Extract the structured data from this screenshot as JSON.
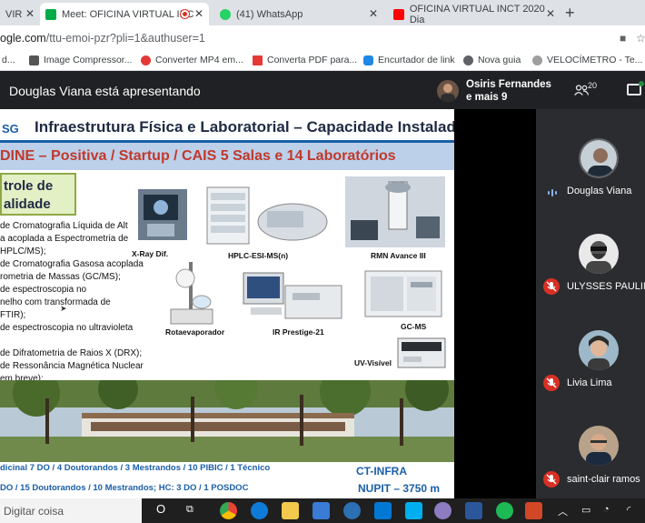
{
  "tabs": [
    {
      "label": "VIR",
      "active": false
    },
    {
      "label": "Meet: OFICINA VIRTUAL INC",
      "active": true
    },
    {
      "label": "(41) WhatsApp",
      "active": false
    },
    {
      "label": "OFICINA VIRTUAL INCT 2020 Dia",
      "active": false
    }
  ],
  "address": {
    "host": "ogle.com",
    "path": "/ttu-emoi-pzr?pli=1&authuser=1"
  },
  "bookmarks": [
    "d...",
    "Image Compressor...",
    "Converter MP4 em...",
    "Converta PDF para...",
    "Encurtador de link",
    "Nova guia",
    "VELOCÍMETRO - Te..."
  ],
  "meet": {
    "presenting_text": "Douglas Viana está apresentando",
    "presenter_line1": "Osiris Fernandes",
    "presenter_line2": "e mais 9",
    "participant_count": "20"
  },
  "slide": {
    "logo": "SG",
    "title": "Infraestrutura Física e Laboratorial – Capacidade Instalada",
    "subtitle": "DINE – Positiva / Startup  / CAIS 5 Salas e 14 Laboratórios",
    "box_line1": "trole de",
    "box_line2": "alidade",
    "bullets": [
      "de Cromatografia Líquida de Alt",
      "a acoplada a Espectrometria de",
      "HPLC/MS);",
      "de Cromatografia Gasosa acoplada",
      "rometria de Massas (GC/MS);",
      "de espectroscopia no",
      "nelho com transformada de",
      "FTIR);",
      "de espectroscopia no ultravioleta",
      "",
      "de Difratometria de Raios X (DRX);",
      "de Ressonância Magnética Nuclear",
      "em breve);"
    ],
    "labels": {
      "xray": "X-Ray Dif.",
      "hplc": "HPLC-ESI-MS(n)",
      "rmn": "RMN Avance III",
      "rota": "Rotaevaporador",
      "ir": "IR Prestige-21",
      "gcms": "GC-MS",
      "uv": "UV-Visível"
    },
    "footer1": "dicinal 7 DO / 4 Doutorandos / 3 Mestrandos / 10 PIBIC / 1 Técnico",
    "footer2": "DO / 15 Doutorandos / 10 Mestrandos; HC: 3 DO / 1 POSDOC",
    "ct_infra": "CT-INFRA",
    "nupit": "NUPIT – 3750 m"
  },
  "participants": [
    {
      "name": "Douglas Viana",
      "muted": false
    },
    {
      "name": "ULYSSES PAULIN",
      "muted": true
    },
    {
      "name": "Livia Lima",
      "muted": true
    },
    {
      "name": "saint-clair ramos",
      "muted": true
    }
  ],
  "taskbar": {
    "search": "Digitar coisa"
  },
  "colors": {
    "meet_bg": "#202124",
    "mute_red": "#d93025",
    "slide_blue": "#1a5fa8",
    "subtitle_red": "#c0392b"
  }
}
